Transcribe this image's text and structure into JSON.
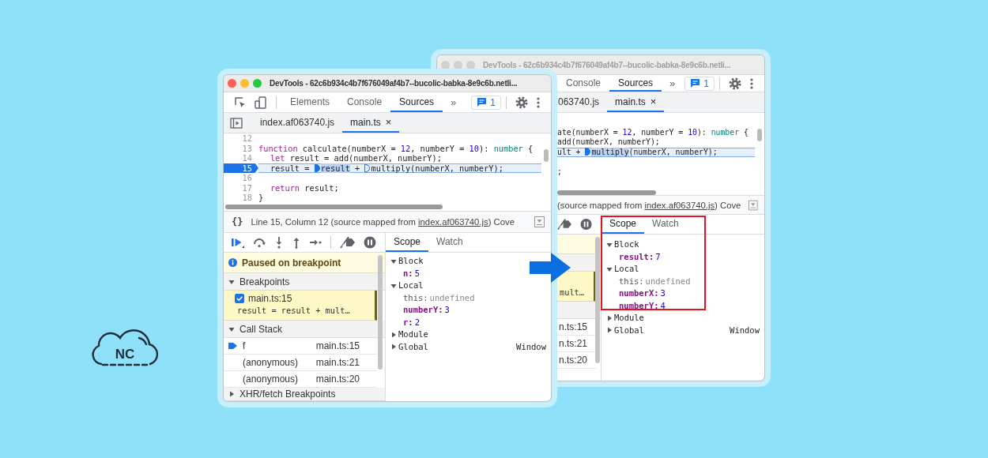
{
  "logo": {
    "text": "NC"
  },
  "back_window": {
    "active": false,
    "title": "DevTools - 62c6b934c4b7f676049af4b7--bucolic-babka-8e9c6b.netli...",
    "tabs": [
      {
        "label": "Console",
        "selected": false
      },
      {
        "label": "Sources",
        "selected": true
      }
    ],
    "more_tabs": "»",
    "issues_count": "1",
    "files": [
      {
        "label": "063740.js",
        "selected": false,
        "closable": false
      },
      {
        "label": "main.ts",
        "selected": true,
        "closable": true
      }
    ],
    "close_mark": "×",
    "code": [
      {
        "paused": false
      },
      {
        "paused": false,
        "tokens": [
          {
            "kind": "plain",
            "text": "ate(numberX = "
          },
          {
            "kind": "number",
            "text": "12"
          },
          {
            "kind": "plain",
            "text": ", numberY = "
          },
          {
            "kind": "number",
            "text": "10"
          },
          {
            "kind": "plain",
            "text": "): "
          },
          {
            "kind": "type",
            "text": "number"
          },
          {
            "kind": "plain",
            "text": " {"
          }
        ]
      },
      {
        "paused": false,
        "tokens": [
          {
            "kind": "plain",
            "text": "add(numberX, numberY);"
          }
        ]
      },
      {
        "paused": true,
        "tokens": [
          {
            "kind": "plain",
            "text": "ult + "
          },
          {
            "kind": "marker",
            "active": true
          },
          {
            "kind": "highlight",
            "text": "multiply"
          },
          {
            "kind": "plain",
            "text": "(numberX, numberY);"
          }
        ]
      },
      {
        "paused": false
      },
      {
        "paused": false,
        "tokens": [
          {
            "kind": "plain",
            "text": ";"
          }
        ]
      }
    ],
    "status": {
      "text": "(source mapped from ",
      "link": "index.af063740.js",
      "suffix": ") Cove"
    },
    "breakpoints": [
      {
        "code": "mult…"
      }
    ],
    "call_frames": [
      {
        "location": "n.ts:15"
      },
      {
        "location": "n.ts:21"
      },
      {
        "location": "n.ts:20"
      }
    ],
    "scope_tabs": [
      {
        "label": "Scope",
        "selected": true
      },
      {
        "label": "Watch",
        "selected": false
      }
    ],
    "scope": [
      {
        "name": "Block",
        "expanded": true,
        "children": [
          {
            "name": "result:",
            "value": "7",
            "kind": "number"
          }
        ]
      },
      {
        "name": "Local",
        "expanded": true,
        "children": [
          {
            "name": "this:",
            "value": "undefined",
            "kind": "undefined"
          },
          {
            "name": "numberX:",
            "value": "3",
            "kind": "number"
          },
          {
            "name": "numberY:",
            "value": "4",
            "kind": "number"
          }
        ]
      },
      {
        "name": "Module",
        "expanded": false
      },
      {
        "name": "Global",
        "expanded": false,
        "value": "Window"
      }
    ],
    "scope_highlight": true
  },
  "front_window": {
    "active": true,
    "title": "DevTools - 62c6b934c4b7f676049af4b7--bucolic-babka-8e9c6b.netli...",
    "tabs": [
      {
        "label": "Elements",
        "selected": false
      },
      {
        "label": "Console",
        "selected": false
      },
      {
        "label": "Sources",
        "selected": true
      }
    ],
    "more_tabs": "»",
    "issues_count": "1",
    "files": [
      {
        "label": "index.af063740.js",
        "selected": false,
        "closable": false
      },
      {
        "label": "main.ts",
        "selected": true,
        "closable": true
      }
    ],
    "close_mark": "×",
    "code": [
      {
        "number": "12",
        "paused": false
      },
      {
        "number": "13",
        "paused": false,
        "tokens": [
          {
            "kind": "keyword",
            "text": "function"
          },
          {
            "kind": "plain",
            "text": " calculate(numberX = "
          },
          {
            "kind": "number",
            "text": "12"
          },
          {
            "kind": "plain",
            "text": ", numberY = "
          },
          {
            "kind": "number",
            "text": "10"
          },
          {
            "kind": "plain",
            "text": "): "
          },
          {
            "kind": "type",
            "text": "number"
          },
          {
            "kind": "plain",
            "text": " {"
          }
        ]
      },
      {
        "number": "14",
        "paused": false,
        "indented": true,
        "tokens": [
          {
            "kind": "keyword",
            "text": "let"
          },
          {
            "kind": "plain",
            "text": " result = add(numberX, numberY);"
          }
        ]
      },
      {
        "number": "15",
        "paused": true,
        "indented": true,
        "tokens": [
          {
            "kind": "plain",
            "text": "result = "
          },
          {
            "kind": "marker",
            "active": true
          },
          {
            "kind": "highlight",
            "text": "result"
          },
          {
            "kind": "plain",
            "text": " + "
          },
          {
            "kind": "marker",
            "active": false
          },
          {
            "kind": "plain",
            "text": "multiply(numberX, numberY);"
          }
        ]
      },
      {
        "number": "16",
        "paused": false
      },
      {
        "number": "17",
        "paused": false,
        "indented": true,
        "tokens": [
          {
            "kind": "keyword",
            "text": "return"
          },
          {
            "kind": "plain",
            "text": " result;"
          }
        ]
      },
      {
        "number": "18",
        "paused": false,
        "tokens": [
          {
            "kind": "plain",
            "text": "}"
          }
        ]
      }
    ],
    "status": {
      "format_button": "{}",
      "text": "Line 15, Column 12 (source mapped from ",
      "link": "index.af063740.js",
      "suffix": ") Cove"
    },
    "paused_message": "Paused on breakpoint",
    "breakpoints_header": {
      "label": "Breakpoints",
      "expanded": true
    },
    "breakpoints": [
      {
        "file": "main.ts:15",
        "code": "result = result + mult…",
        "checked": true
      }
    ],
    "call_stack_header": {
      "label": "Call Stack",
      "expanded": true
    },
    "call_frames": [
      {
        "name": "f",
        "location": "main.ts:15",
        "current": true
      },
      {
        "name": "(anonymous)",
        "location": "main.ts:21",
        "current": false
      },
      {
        "name": "(anonymous)",
        "location": "main.ts:20",
        "current": false
      }
    ],
    "xhr_header": {
      "label": "XHR/fetch Breakpoints",
      "expanded": false
    },
    "scope_tabs": [
      {
        "label": "Scope",
        "selected": true
      },
      {
        "label": "Watch",
        "selected": false
      }
    ],
    "scope": [
      {
        "name": "Block",
        "expanded": true,
        "children": [
          {
            "name": "n:",
            "value": "5",
            "kind": "number"
          }
        ]
      },
      {
        "name": "Local",
        "expanded": true,
        "children": [
          {
            "name": "this:",
            "value": "undefined",
            "kind": "undefined"
          },
          {
            "name": "numberY:",
            "value": "3",
            "kind": "number"
          },
          {
            "name": "r:",
            "value": "2",
            "kind": "number"
          }
        ]
      },
      {
        "name": "Module",
        "expanded": false
      },
      {
        "name": "Global",
        "expanded": false,
        "value": "Window"
      }
    ]
  }
}
